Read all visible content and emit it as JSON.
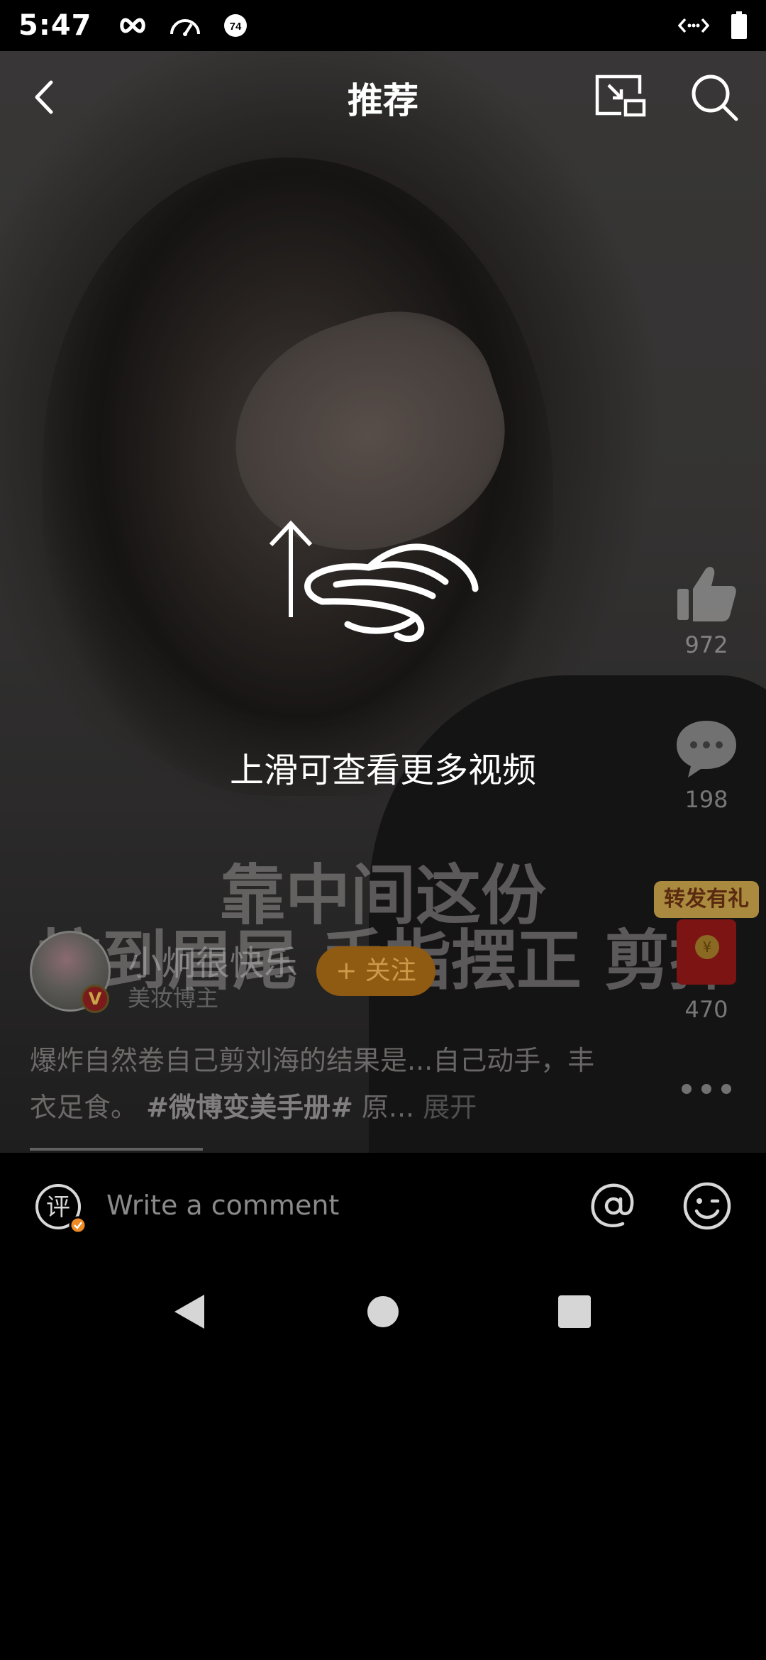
{
  "status_bar": {
    "time": "5:47",
    "icons_left": [
      "infinity-icon",
      "speedometer-icon",
      "notification-74-icon"
    ],
    "badge_number": "74",
    "icons_right": [
      "code-brackets-icon",
      "battery-icon"
    ]
  },
  "nav": {
    "title": "推荐"
  },
  "overlay": {
    "hint": "上滑可查看更多视频"
  },
  "video_caption": {
    "line1": "靠中间这份",
    "line2": "拉到眉尾 手指摆正 剪掉"
  },
  "actions": {
    "like_count": "972",
    "comment_count": "198",
    "forward_tag": "转发有礼",
    "forward_count": "470",
    "coin_symbol": "¥"
  },
  "author": {
    "name": "小炯很快乐",
    "tag": "美妆博主",
    "verified_badge": "V",
    "follow_label": "+ 关注"
  },
  "description": {
    "text": "爆炸自然卷自己剪刘海的结果是...自己动手，丰衣足食。",
    "hashtag": "#微博变美手册#",
    "suffix": "原...",
    "expand_label": "展开"
  },
  "comment_bar": {
    "icon_char": "评",
    "placeholder": "Write a comment"
  },
  "colors": {
    "follow_bg": "#8f5a12",
    "gift_tag_bg": "#a98a3e",
    "red_packet": "#7d1414",
    "badge_check": "#f08a24"
  }
}
